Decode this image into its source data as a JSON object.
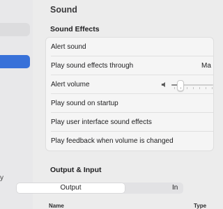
{
  "sidebar": {
    "selected_item_label": "",
    "peek_text": "y"
  },
  "page": {
    "title": "Sound"
  },
  "sound_effects": {
    "section_title": "Sound Effects",
    "rows": [
      {
        "label": "Alert sound"
      },
      {
        "label": "Play sound effects through",
        "value": "Ma"
      },
      {
        "label": "Alert volume",
        "level": 0.2
      },
      {
        "label": "Play sound on startup"
      },
      {
        "label": "Play user interface sound effects"
      },
      {
        "label": "Play feedback when volume is changed"
      }
    ]
  },
  "output_input": {
    "section_title": "Output & Input",
    "tabs": [
      {
        "label": "Output",
        "selected": true
      },
      {
        "label": "In",
        "selected": false
      }
    ],
    "columns": [
      "Name",
      "Type"
    ]
  },
  "colors": {
    "accent": "#3871d9",
    "window_bg": "#ececec",
    "group_bg": "#f5f5f5"
  },
  "icons": {
    "volume": "speaker-icon"
  }
}
